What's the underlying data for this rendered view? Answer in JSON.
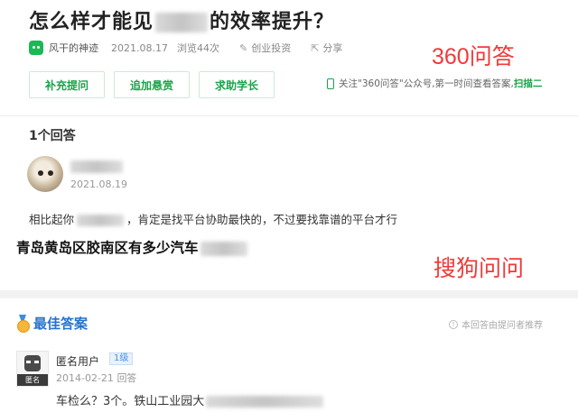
{
  "qa360": {
    "title_prefix": "怎么样才能见",
    "title_suffix": "的效率提升？",
    "author": "风干的神迹",
    "date": "2021.08.17",
    "views": "浏览44次",
    "category": "创业投资",
    "share": "分享",
    "buttons": [
      "补充提问",
      "追加悬赏",
      "求助学长"
    ],
    "watermark": "360问答",
    "follow_tip": "关注\"360问答\"公众号,第一时间查看答案,",
    "follow_scan": "扫描二",
    "answer_count": "1个回答",
    "answer_date": "2021.08.19",
    "answer_prefix": "相比起你",
    "answer_suffix": "，肯定是找平台协助最快的，不过要找靠谱的平台才行"
  },
  "sogou": {
    "title": "青岛黄岛区胶南区有多少汽车",
    "watermark": "搜狗问问",
    "best_label": "最佳答案",
    "recommend_tip": "本回答由提问者推荐",
    "user": "匿名用户",
    "level": "1级",
    "avatar_tag": "匿名",
    "date": "2014-02-21",
    "reply_link": "回答",
    "answer_prefix": "车检么？3个。铁山工业园大"
  },
  "colors": {
    "green": "#1aa34a",
    "blue": "#2673cf",
    "red_watermark": "#f03a3a"
  }
}
